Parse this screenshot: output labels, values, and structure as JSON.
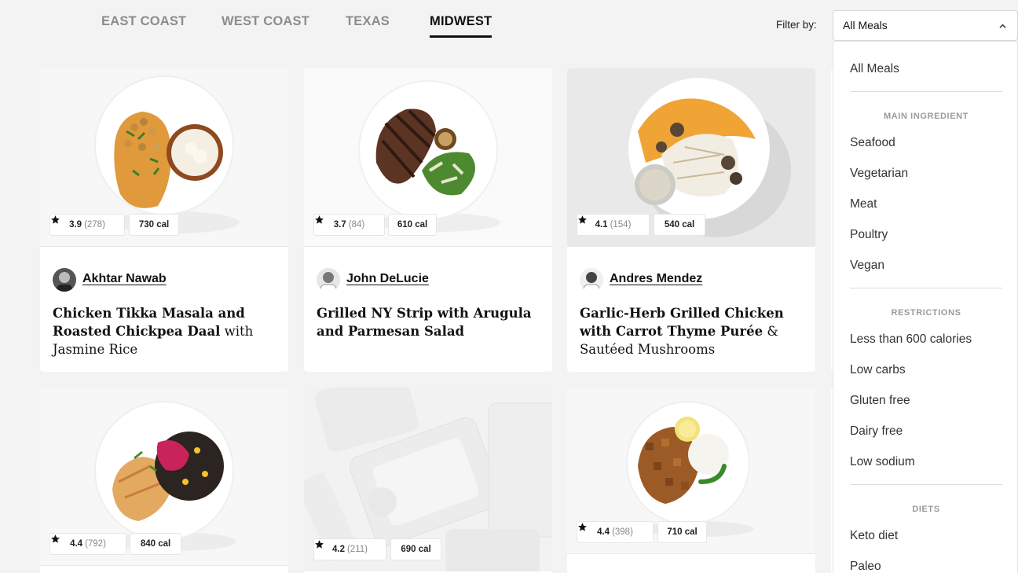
{
  "region_nav": {
    "tabs": [
      {
        "label": "EAST COAST",
        "active": false
      },
      {
        "label": "WEST COAST",
        "active": false
      },
      {
        "label": "TEXAS",
        "active": false
      },
      {
        "label": "MIDWEST",
        "active": true
      }
    ]
  },
  "filter": {
    "label": "Filter by:",
    "selected": "All Meals",
    "icon": "chevron-up-icon"
  },
  "dropdown": {
    "top_option": "All Meals",
    "groups": [
      {
        "heading": "MAIN INGREDIENT",
        "options": [
          "Seafood",
          "Vegetarian",
          "Meat",
          "Poultry",
          "Vegan"
        ]
      },
      {
        "heading": "RESTRICTIONS",
        "options": [
          "Less than 600 calories",
          "Low carbs",
          "Gluten free",
          "Dairy free",
          "Low sodium"
        ]
      },
      {
        "heading": "DIETS",
        "options": [
          "Keto diet",
          "Paleo"
        ]
      }
    ]
  },
  "meals": [
    {
      "rating": "3.9",
      "reviews": "(278)",
      "calories": "730 cal",
      "chef": "Akhtar Nawab",
      "title_bold": "Chicken Tikka Masala and Roasted Chickpea Daal",
      "title_rest": " with Jasmine Rice",
      "image": "chicken-tikka-masala-plate"
    },
    {
      "rating": "3.7",
      "reviews": "(84)",
      "calories": "610 cal",
      "chef": "John DeLucie",
      "title_bold": "Grilled NY Strip with Arugula and Parmesan Salad",
      "title_rest": "",
      "image": "grilled-steak-plate"
    },
    {
      "rating": "4.1",
      "reviews": "(154)",
      "calories": "540 cal",
      "chef": "Andres Mendez",
      "title_bold": "Garlic-Herb Grilled Chicken with Carrot Thyme Purée",
      "title_rest": " & Sautéed Mushrooms",
      "image": "grilled-chicken-puree-plate"
    },
    {
      "rating": "4.4",
      "reviews": "(792)",
      "calories": "840 cal",
      "image": "salmon-black-bean-plate"
    },
    {
      "rating": "4.2",
      "reviews": "(211)",
      "calories": "690 cal",
      "image": "meal-packaging-placeholder"
    },
    {
      "rating": "4.4",
      "reviews": "(398)",
      "calories": "710 cal",
      "image": "tofu-rice-plate"
    }
  ],
  "colors": {
    "background": "#f3f3f3",
    "card": "#ffffff",
    "active_tab": "#111111",
    "inactive_tab": "#8c8c8c"
  }
}
